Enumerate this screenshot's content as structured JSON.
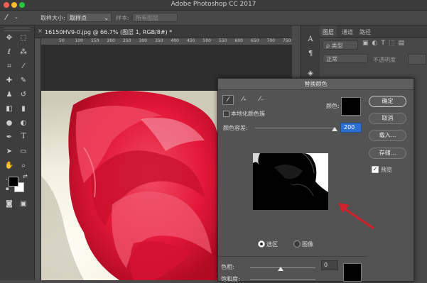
{
  "app": {
    "title": "Adobe Photoshop CC 2017"
  },
  "options_bar": {
    "sample_size_label": "取样大小:",
    "sample_size_value": "取样点",
    "sample_label": "样本:",
    "sample_value": "所有图层"
  },
  "document": {
    "tab_title": "16150HV9-0.jpg @ 66.7% (图层 1, RGB/8#) *",
    "ruler_ticks": [
      "50",
      "100",
      "150",
      "200",
      "250",
      "300",
      "350",
      "400",
      "450",
      "500",
      "550",
      "600",
      "650",
      "700",
      "750"
    ]
  },
  "layers_panel": {
    "tabs": [
      "图层",
      "通道",
      "路径"
    ],
    "filter_label": "ρ 类型",
    "blend_mode": "正常",
    "opacity_label": "不透明度"
  },
  "dialog": {
    "title": "替换颜色",
    "localized_label": "本地化颜色簇",
    "color_label": "颜色:",
    "fuzziness_label": "颜色容差:",
    "fuzziness_value": "200",
    "fuzziness_fraction": 0.98,
    "radio_selection": "选区",
    "radio_image": "图像",
    "selected_mode": "selection",
    "hue_label": "色相:",
    "hue_value": "0",
    "saturation_label": "饱和度:",
    "buttons": {
      "ok": "确定",
      "cancel": "取消",
      "load": "载入...",
      "save": "存储..."
    },
    "preview_label": "预览",
    "preview_checked": true,
    "color_swatch": "#000000"
  },
  "colors": {
    "accent": "#2d6fd1",
    "arrow": "#d4202a",
    "foreground": "#000000",
    "background": "#ffffff"
  }
}
